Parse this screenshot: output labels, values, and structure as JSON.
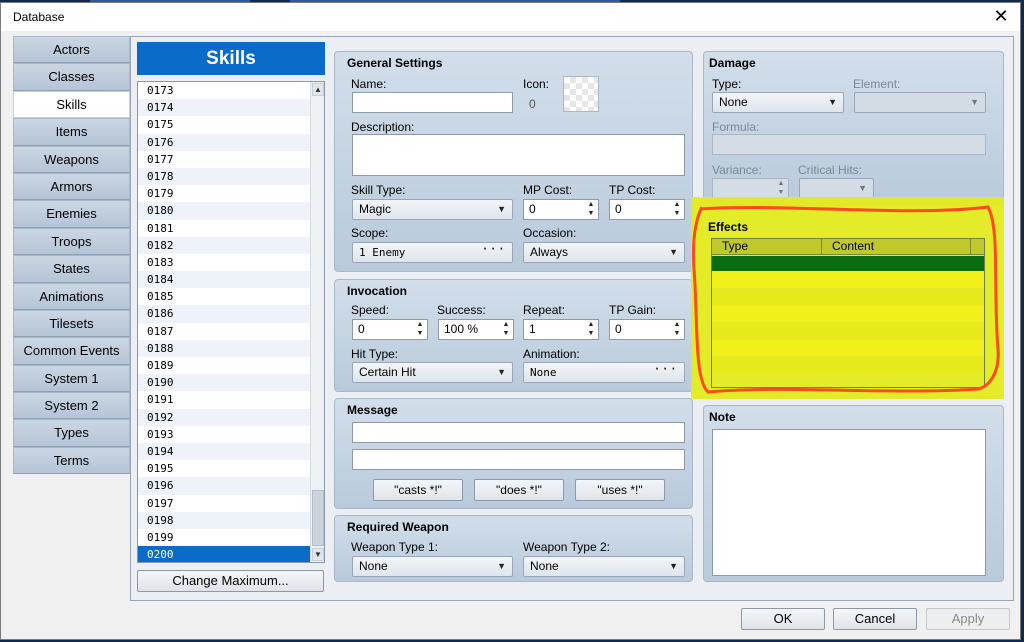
{
  "window": {
    "title": "Database",
    "close": "✕"
  },
  "categories": [
    "Actors",
    "Classes",
    "Skills",
    "Items",
    "Weapons",
    "Armors",
    "Enemies",
    "Troops",
    "States",
    "Animations",
    "Tilesets",
    "Common Events",
    "System 1",
    "System 2",
    "Types",
    "Terms"
  ],
  "active_category": "Skills",
  "list": {
    "header": "Skills",
    "items": [
      "0173",
      "0174",
      "0175",
      "0176",
      "0177",
      "0178",
      "0179",
      "0180",
      "0181",
      "0182",
      "0183",
      "0184",
      "0185",
      "0186",
      "0187",
      "0188",
      "0189",
      "0190",
      "0191",
      "0192",
      "0193",
      "0194",
      "0195",
      "0196",
      "0197",
      "0198",
      "0199",
      "0200"
    ],
    "selected": "0200",
    "change_max": "Change Maximum..."
  },
  "general": {
    "title": "General Settings",
    "name_label": "Name:",
    "name_value": "",
    "icon_label": "Icon:",
    "icon_index": "0",
    "desc_label": "Description:",
    "desc_value": "",
    "skill_type_label": "Skill Type:",
    "skill_type": "Magic",
    "mp_cost_label": "MP Cost:",
    "mp_cost": "0",
    "tp_cost_label": "TP Cost:",
    "tp_cost": "0",
    "scope_label": "Scope:",
    "scope": "1 Enemy",
    "occasion_label": "Occasion:",
    "occasion": "Always"
  },
  "invocation": {
    "title": "Invocation",
    "speed_label": "Speed:",
    "speed": "0",
    "success_label": "Success:",
    "success": "100 %",
    "repeat_label": "Repeat:",
    "repeat": "1",
    "tp_gain_label": "TP Gain:",
    "tp_gain": "0",
    "hit_type_label": "Hit Type:",
    "hit_type": "Certain Hit",
    "animation_label": "Animation:",
    "animation": "None"
  },
  "message": {
    "title": "Message",
    "line1": "",
    "line2": "",
    "casts": "\"casts *!\"",
    "does": "\"does *!\"",
    "uses": "\"uses *!\""
  },
  "required_weapon": {
    "title": "Required Weapon",
    "wt1_label": "Weapon Type 1:",
    "wt1": "None",
    "wt2_label": "Weapon Type 2:",
    "wt2": "None"
  },
  "damage": {
    "title": "Damage",
    "type_label": "Type:",
    "type": "None",
    "element_label": "Element:",
    "element": "",
    "formula_label": "Formula:",
    "formula": "",
    "variance_label": "Variance:",
    "variance": "",
    "critical_label": "Critical Hits:",
    "critical": ""
  },
  "effects": {
    "title": "Effects",
    "col_type": "Type",
    "col_content": "Content"
  },
  "note": {
    "title": "Note",
    "value": ""
  },
  "buttons": {
    "ok": "OK",
    "cancel": "Cancel",
    "apply": "Apply"
  },
  "colors": {
    "accent": "#0b6bc9",
    "highlight": "#e4ea1c",
    "annotation": "#ff4a1c",
    "selected_row": "#0a6d12"
  }
}
